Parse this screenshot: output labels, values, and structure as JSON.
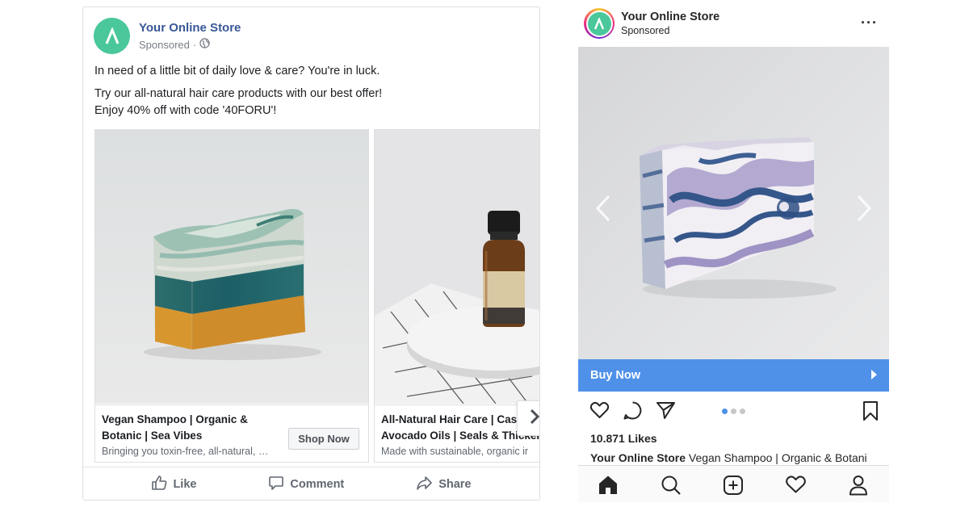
{
  "facebook": {
    "page_name": "Your Online Store",
    "sponsored": "Sponsored",
    "separator": "·",
    "post_text": [
      "In need of a little bit of daily love & care? You're in luck.",
      "Try our all-natural hair care products with our best offer!",
      "Enjoy 40% off with code '40FORU'!"
    ],
    "cards": [
      {
        "title_line1": "Vegan Shampoo | Organic &",
        "title_line2": "Botanic | Sea Vibes",
        "description": "Bringing you toxin-free, all-natural, …",
        "button": "Shop Now"
      },
      {
        "title_line1": "All-Natural Hair Care | Castor &",
        "title_line2": "Avocado Oils | Seals & Thicker",
        "description": "Made with sustainable, organic ir"
      }
    ],
    "actions": {
      "like": "Like",
      "comment": "Comment",
      "share": "Share"
    }
  },
  "instagram": {
    "page_name": "Your Online Store",
    "sponsored": "Sponsored",
    "more": "···",
    "cta": "Buy Now",
    "likes": "10.871 Likes",
    "caption_name": "Your Online Store",
    "caption_text": " Vegan Shampoo | Organic & Botani",
    "carousel_dots": {
      "count": 3,
      "active": 1
    }
  },
  "colors": {
    "brand_green": "#4ac79b",
    "facebook_link": "#385898",
    "instagram_cta": "#4f91e8"
  },
  "icons": [
    "globe-icon",
    "chevron-right-icon",
    "like-icon",
    "comment-icon",
    "share-icon",
    "heart-icon",
    "message-icon",
    "send-icon",
    "bookmark-icon",
    "home-icon",
    "search-icon",
    "add-icon",
    "profile-icon",
    "chevron-left-icon"
  ]
}
